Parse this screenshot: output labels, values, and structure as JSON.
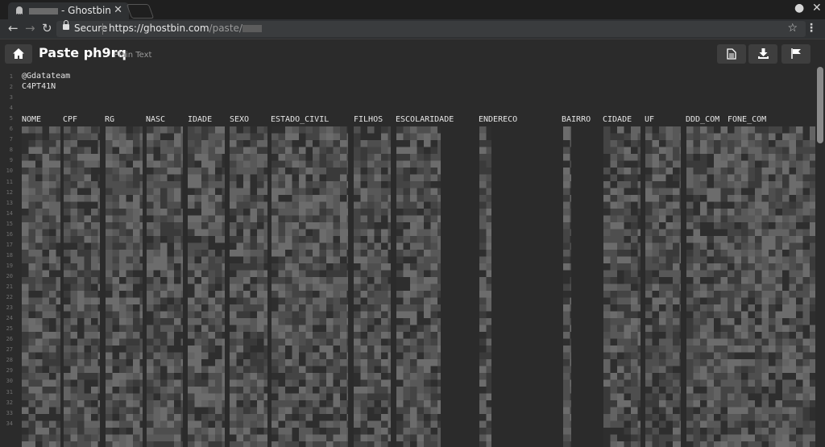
{
  "browser": {
    "tab_title": "- Ghostbin",
    "secure_label": "Secure",
    "url_base": "https://ghostbin.com",
    "url_path": "/paste/"
  },
  "header": {
    "title": "Paste ph9rq",
    "language": "Plain Text"
  },
  "code": {
    "line1": "@Gdatateam",
    "line2": "C4PT41N",
    "line_numbers": [
      "1",
      "2",
      "3",
      "4",
      "5",
      "6",
      "7",
      "8",
      "9",
      "10",
      "11",
      "12",
      "13",
      "14",
      "15",
      "16",
      "17",
      "18",
      "19",
      "20",
      "21",
      "22",
      "23",
      "24",
      "25",
      "26",
      "27",
      "28",
      "29",
      "30",
      "31",
      "32",
      "33",
      "34"
    ],
    "columns": [
      "NOME",
      "CPF",
      "RG",
      "NASC",
      "IDADE",
      "SEXO",
      "ESTADO_CIVIL",
      "FILHOS",
      "ESCOLARIDADE",
      "ENDERECO",
      "BAIRRO",
      "CIDADE",
      "UF",
      "DDD_COM",
      "FONE_COM"
    ]
  },
  "colors": {
    "background": "#2b2b2b",
    "chrome": "#1f1f1f",
    "text": "#e6e6e6"
  }
}
